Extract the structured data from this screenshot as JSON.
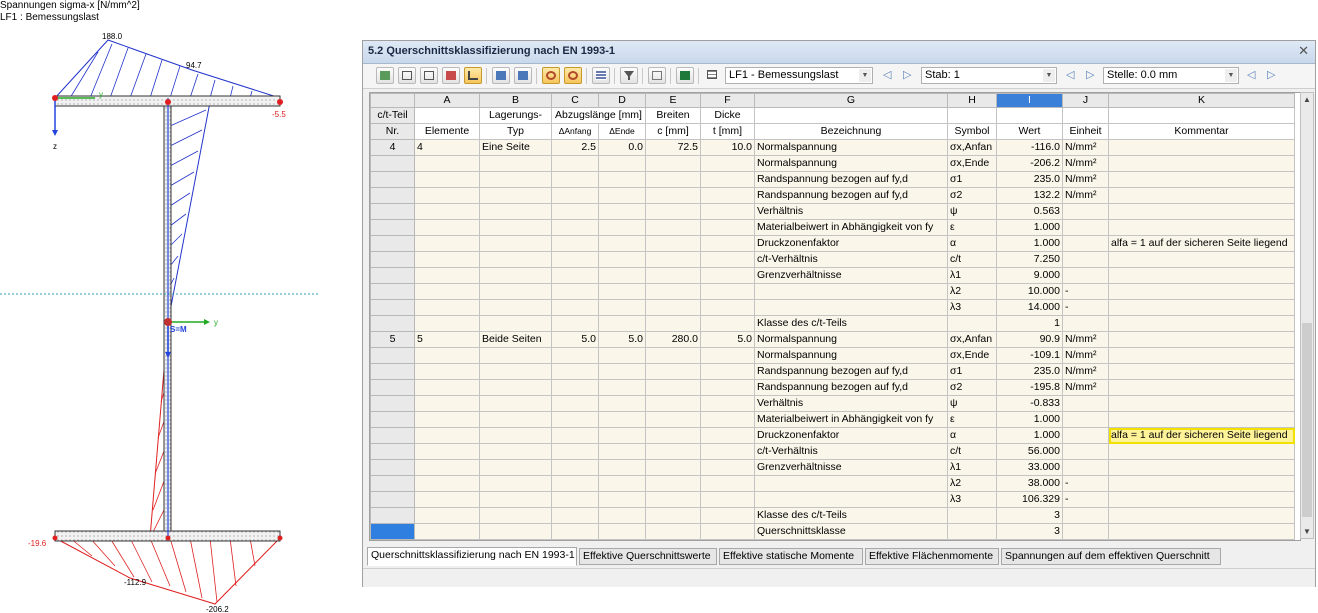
{
  "diagram": {
    "caption_line1": "Spannungen sigma-x [N/mm^2]",
    "caption_line2": "LF1 : Bemessungslast",
    "values": {
      "top_left": "188.0",
      "top_mid": "94.7",
      "flange_right": "-5.5",
      "bottom_left": "-19.6",
      "bottom_mid": "-112.9",
      "bottom_right": "-206.2"
    },
    "axis_z": "z",
    "axis_y_top": "y",
    "axis_y_mid": "y",
    "center_label": "S=M",
    "colors": {
      "tension": "#2233cc",
      "compression": "#e02020",
      "axis_green": "#22aa22",
      "axis_blue": "#2244dd",
      "neutral_line": "#2aa0b0"
    }
  },
  "window": {
    "title": "5.2 Querschnittsklassifizierung nach EN 1993-1",
    "close_icon": "close-icon"
  },
  "toolbar": {
    "loadcase": "LF1 - Bemessungslast",
    "stab_label": "Stab: 1",
    "stelle_label": "Stelle: 0.0 mm",
    "icons": [
      "graphics-icon",
      "insert-row-icon",
      "delete-row-icon",
      "table-icon",
      "filter-icon",
      "import-icon",
      "export-icon",
      "undo-icon",
      "redo-icon",
      "columns-icon",
      "funnel-icon",
      "view-icon",
      "excel-icon",
      "table-settings-icon"
    ]
  },
  "table": {
    "col_letters": [
      "A",
      "B",
      "C",
      "D",
      "E",
      "F",
      "G",
      "H",
      "I",
      "J",
      "K"
    ],
    "head1": {
      "rownr": "c/t-Teil",
      "b": "Lagerungs-",
      "cd": "Abzugslänge [mm]",
      "e": "Breiten",
      "f": "Dicke"
    },
    "head2": {
      "rownr": "Nr.",
      "a": "Elemente",
      "b": "Typ",
      "c": "ΔAnfang",
      "d": "ΔEnde",
      "e": "c [mm]",
      "f": "t [mm]",
      "g": "Bezeichnung",
      "h": "Symbol",
      "i": "Wert",
      "j": "Einheit",
      "k": "Kommentar"
    },
    "rows": [
      {
        "nr": "4",
        "a": "4",
        "b": "Eine Seite",
        "c": "2.5",
        "d": "0.0",
        "e": "72.5",
        "f": "10.0",
        "g": "Normalspannung",
        "h": "σx,Anfan",
        "i": "-116.0",
        "j": "N/mm²",
        "k": ""
      },
      {
        "nr": "",
        "a": "",
        "b": "",
        "c": "",
        "d": "",
        "e": "",
        "f": "",
        "g": "Normalspannung",
        "h": "σx,Ende",
        "i": "-206.2",
        "j": "N/mm²",
        "k": ""
      },
      {
        "nr": "",
        "a": "",
        "b": "",
        "c": "",
        "d": "",
        "e": "",
        "f": "",
        "g": "Randspannung bezogen auf fy,d",
        "h": "σ1",
        "i": "235.0",
        "j": "N/mm²",
        "k": ""
      },
      {
        "nr": "",
        "a": "",
        "b": "",
        "c": "",
        "d": "",
        "e": "",
        "f": "",
        "g": "Randspannung bezogen auf fy,d",
        "h": "σ2",
        "i": "132.2",
        "j": "N/mm²",
        "k": ""
      },
      {
        "nr": "",
        "a": "",
        "b": "",
        "c": "",
        "d": "",
        "e": "",
        "f": "",
        "g": "Verhältnis",
        "h": "ψ",
        "i": "0.563",
        "j": "",
        "k": ""
      },
      {
        "nr": "",
        "a": "",
        "b": "",
        "c": "",
        "d": "",
        "e": "",
        "f": "",
        "g": "Materialbeiwert in Abhängigkeit von fy",
        "h": "ε",
        "i": "1.000",
        "j": "",
        "k": ""
      },
      {
        "nr": "",
        "a": "",
        "b": "",
        "c": "",
        "d": "",
        "e": "",
        "f": "",
        "g": "Druckzonenfaktor",
        "h": "α",
        "i": "1.000",
        "j": "",
        "k": "alfa = 1 auf der sicheren Seite liegend"
      },
      {
        "nr": "",
        "a": "",
        "b": "",
        "c": "",
        "d": "",
        "e": "",
        "f": "",
        "g": "c/t-Verhältnis",
        "h": "c/t",
        "i": "7.250",
        "j": "",
        "k": ""
      },
      {
        "nr": "",
        "a": "",
        "b": "",
        "c": "",
        "d": "",
        "e": "",
        "f": "",
        "g": "Grenzverhältnisse",
        "h": "λ1",
        "i": "9.000",
        "j": "",
        "k": ""
      },
      {
        "nr": "",
        "a": "",
        "b": "",
        "c": "",
        "d": "",
        "e": "",
        "f": "",
        "g": "",
        "h": "λ2",
        "i": "10.000",
        "j": "-",
        "k": ""
      },
      {
        "nr": "",
        "a": "",
        "b": "",
        "c": "",
        "d": "",
        "e": "",
        "f": "",
        "g": "",
        "h": "λ3",
        "i": "14.000",
        "j": "-",
        "k": ""
      },
      {
        "nr": "",
        "a": "",
        "b": "",
        "c": "",
        "d": "",
        "e": "",
        "f": "",
        "g": "Klasse des c/t-Teils",
        "h": "",
        "i": "1",
        "j": "",
        "k": ""
      },
      {
        "nr": "5",
        "a": "5",
        "b": "Beide Seiten",
        "c": "5.0",
        "d": "5.0",
        "e": "280.0",
        "f": "5.0",
        "g": "Normalspannung",
        "h": "σx,Anfan",
        "i": "90.9",
        "j": "N/mm²",
        "k": ""
      },
      {
        "nr": "",
        "a": "",
        "b": "",
        "c": "",
        "d": "",
        "e": "",
        "f": "",
        "g": "Normalspannung",
        "h": "σx,Ende",
        "i": "-109.1",
        "j": "N/mm²",
        "k": ""
      },
      {
        "nr": "",
        "a": "",
        "b": "",
        "c": "",
        "d": "",
        "e": "",
        "f": "",
        "g": "Randspannung bezogen auf fy,d",
        "h": "σ1",
        "i": "235.0",
        "j": "N/mm²",
        "k": ""
      },
      {
        "nr": "",
        "a": "",
        "b": "",
        "c": "",
        "d": "",
        "e": "",
        "f": "",
        "g": "Randspannung bezogen auf fy,d",
        "h": "σ2",
        "i": "-195.8",
        "j": "N/mm²",
        "k": ""
      },
      {
        "nr": "",
        "a": "",
        "b": "",
        "c": "",
        "d": "",
        "e": "",
        "f": "",
        "g": "Verhältnis",
        "h": "ψ",
        "i": "-0.833",
        "j": "",
        "k": ""
      },
      {
        "nr": "",
        "a": "",
        "b": "",
        "c": "",
        "d": "",
        "e": "",
        "f": "",
        "g": "Materialbeiwert in Abhängigkeit von fy",
        "h": "ε",
        "i": "1.000",
        "j": "",
        "k": ""
      },
      {
        "nr": "",
        "a": "",
        "b": "",
        "c": "",
        "d": "",
        "e": "",
        "f": "",
        "g": "Druckzonenfaktor",
        "h": "α",
        "i": "1.000",
        "j": "",
        "k": "alfa = 1 auf der sicheren Seite liegend",
        "highlight": true
      },
      {
        "nr": "",
        "a": "",
        "b": "",
        "c": "",
        "d": "",
        "e": "",
        "f": "",
        "g": "c/t-Verhältnis",
        "h": "c/t",
        "i": "56.000",
        "j": "",
        "k": ""
      },
      {
        "nr": "",
        "a": "",
        "b": "",
        "c": "",
        "d": "",
        "e": "",
        "f": "",
        "g": "Grenzverhältnisse",
        "h": "λ1",
        "i": "33.000",
        "j": "",
        "k": ""
      },
      {
        "nr": "",
        "a": "",
        "b": "",
        "c": "",
        "d": "",
        "e": "",
        "f": "",
        "g": "",
        "h": "λ2",
        "i": "38.000",
        "j": "-",
        "k": ""
      },
      {
        "nr": "",
        "a": "",
        "b": "",
        "c": "",
        "d": "",
        "e": "",
        "f": "",
        "g": "",
        "h": "λ3",
        "i": "106.329",
        "j": "-",
        "k": ""
      },
      {
        "nr": "",
        "a": "",
        "b": "",
        "c": "",
        "d": "",
        "e": "",
        "f": "",
        "g": "Klasse des c/t-Teils",
        "h": "",
        "i": "3",
        "j": "",
        "k": ""
      },
      {
        "nr": "",
        "a": "",
        "b": "",
        "c": "",
        "d": "",
        "e": "",
        "f": "",
        "g": "Querschnittsklasse",
        "h": "",
        "i": "3",
        "j": "",
        "k": "",
        "current": true
      }
    ]
  },
  "tabs": [
    "Querschnittsklassifizierung nach EN 1993-1",
    "Effektive Querschnittswerte",
    "Effektive statische Momente",
    "Effektive Flächenmomente",
    "Spannungen auf dem effektiven Querschnitt"
  ]
}
